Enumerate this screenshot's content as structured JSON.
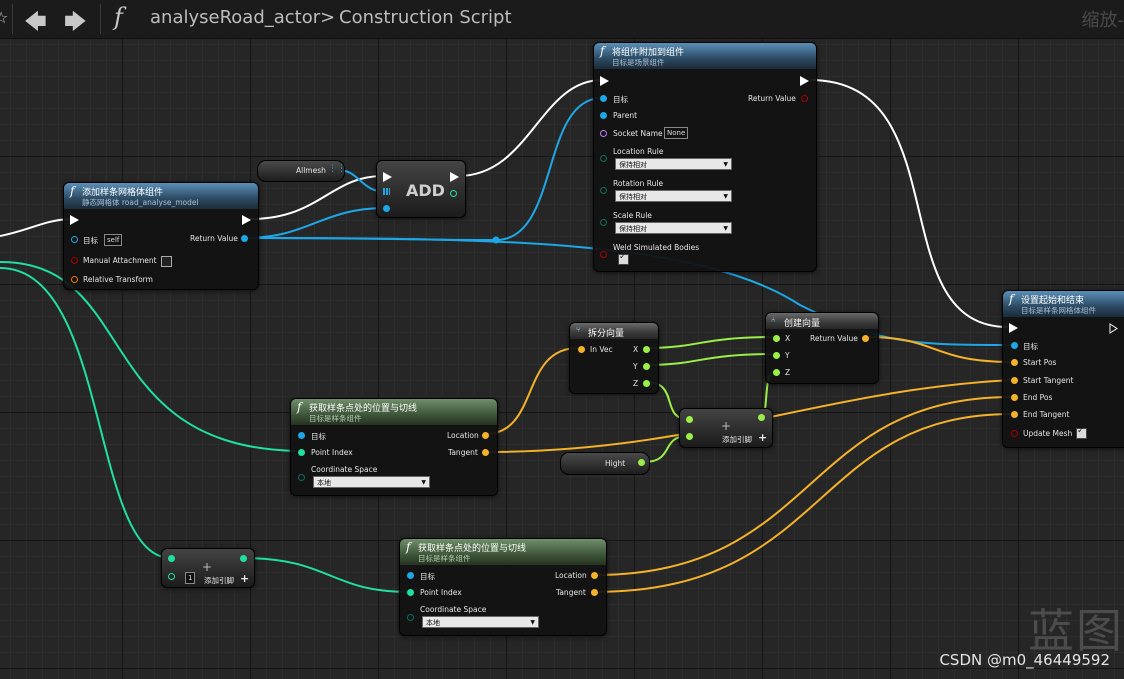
{
  "window": {
    "breadcrumb_function": "analyseRoad_actor",
    "breadcrumb_separator": ">",
    "breadcrumb_graph": "Construction Script",
    "zoom_label": "缩放-",
    "icons": [
      "star-icon",
      "back-arrow-icon",
      "forward-arrow-icon",
      "function-icon"
    ]
  },
  "nodes": {
    "add_spline_mesh": {
      "title": "添加样条网格体组件",
      "subtitle": "静态网格体 road_analyse_model",
      "target_label": "目标",
      "target_value": "self",
      "return_label": "Return Value",
      "manual_attachment": "Manual Attachment",
      "relative_transform": "Relative Transform"
    },
    "allmesh": {
      "label": "Allmesh"
    },
    "add": {
      "label": "ADD"
    },
    "attach": {
      "title": "将组件附加到组件",
      "subtitle": "目标是场景组件",
      "target_label": "目标",
      "return_label": "Return Value",
      "parent_label": "Parent",
      "socket_label": "Socket Name",
      "socket_value": "None",
      "location_rule": "Location Rule",
      "location_value": "保持相对",
      "rotation_rule": "Rotation Rule",
      "rotation_value": "保持相对",
      "scale_rule": "Scale Rule",
      "scale_value": "保持相对",
      "weld": "Weld Simulated Bodies"
    },
    "set_start_end": {
      "title": "设置起始和结束",
      "subtitle": "目标是样条网格体组件",
      "target_label": "目标",
      "start_pos": "Start Pos",
      "start_tangent": "Start Tangent",
      "end_pos": "End Pos",
      "end_tangent": "End Tangent",
      "update_mesh": "Update Mesh"
    },
    "break_vector": {
      "title": "拆分向量",
      "in_vec": "In Vec",
      "x": "X",
      "y": "Y",
      "z": "Z"
    },
    "make_vector": {
      "title": "创建向量",
      "x": "X",
      "y": "Y",
      "z": "Z",
      "return_label": "Return Value"
    },
    "get_loc_tan_1": {
      "title": "获取样条点处的位置与切线",
      "subtitle": "目标是样条组件",
      "target_label": "目标",
      "point_index": "Point Index",
      "location": "Location",
      "tangent": "Tangent",
      "coord_space": "Coordinate Space",
      "coord_value": "本地"
    },
    "get_loc_tan_2": {
      "title": "获取样条点处的位置与切线",
      "subtitle": "目标是样条组件",
      "target_label": "目标",
      "point_index": "Point Index",
      "location": "Location",
      "tangent": "Tangent",
      "coord_space": "Coordinate Space",
      "coord_value": "本地"
    },
    "add_float": {
      "add_pin": "添加引脚"
    },
    "add_int": {
      "add_pin": "添加引脚",
      "value": "1"
    },
    "hight": {
      "label": "Hight"
    }
  },
  "colors": {
    "exec": "#ffffff",
    "object_pin": "#1ea7e6",
    "float_pin": "#9bef49",
    "int_pin": "#1fe0a3",
    "vector_pin": "#f3b22a",
    "bool_pin": "#a80000",
    "transform_pin": "#ed7316",
    "name_pin": "#c87bff",
    "enum_pin": "#0a6b5b"
  },
  "watermark": "CSDN @m0_46449592",
  "logo_text": "蓝图"
}
